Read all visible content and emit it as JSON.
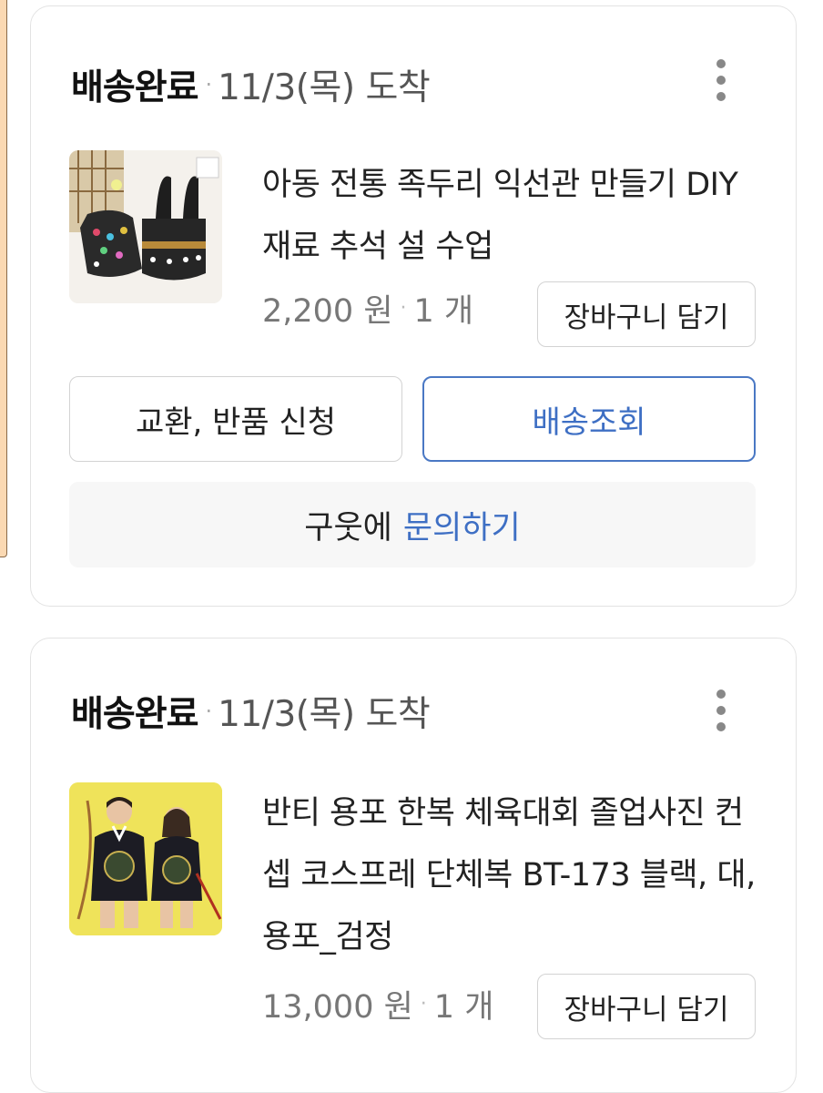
{
  "orders": [
    {
      "status": "배송완료",
      "arrival": "11/3(목) 도착",
      "product_title": "아동 전통 족두리 익선관 만들기 DIY 재료 추석 설 수업",
      "price": "2,200 원",
      "quantity": "1 개",
      "cart_button": "장바구니 담기",
      "exchange_button": "교환, 반품 신청",
      "track_button": "배송조회",
      "seller_name": "구웃에",
      "inquiry_link": "문의하기",
      "more_icon": "more-vertical-icon"
    },
    {
      "status": "배송완료",
      "arrival": "11/3(목) 도착",
      "product_title": "반티 용포 한복 체육대회 졸업사진 컨셉 코스프레 단체복 BT-173 블랙, 대, 용포_검정",
      "price": "13,000 원",
      "quantity": "1 개",
      "cart_button": "장바구니 담기",
      "more_icon": "more-vertical-icon"
    }
  ],
  "colors": {
    "accent_blue": "#3e6fc4",
    "border": "#d3d3d3",
    "inquiry_bg": "#f7f7f7"
  }
}
